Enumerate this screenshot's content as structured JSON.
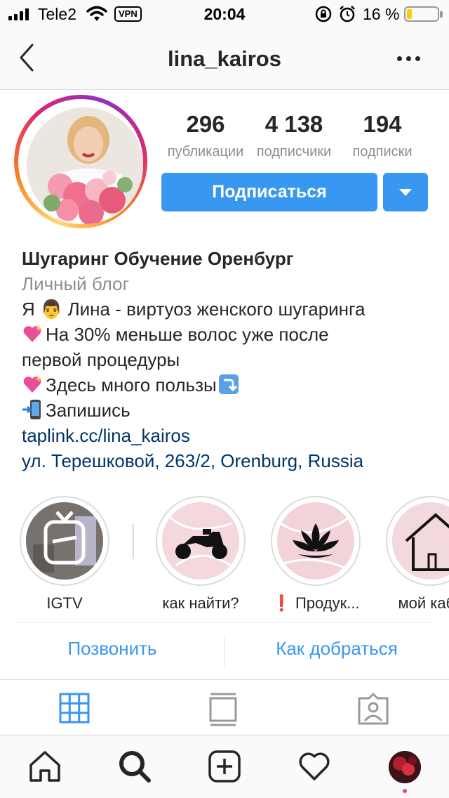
{
  "status_bar": {
    "carrier": "Tele2",
    "vpn": "VPN",
    "time": "20:04",
    "battery_text": "16 %",
    "battery_level": 0.16,
    "battery_color": "#ffcc00"
  },
  "nav": {
    "title": "lina_kairos"
  },
  "profile": {
    "stats": [
      {
        "value": "296",
        "label": "публикации"
      },
      {
        "value": "4 138",
        "label": "подписчики"
      },
      {
        "value": "194",
        "label": "подписки"
      }
    ],
    "follow_label": "Подписаться",
    "accent_color": "#3897f0"
  },
  "bio": {
    "name": "Шугаринг Обучение Оренбург",
    "category": "Личный блог",
    "line1": "Я 👨 Лина - виртуоз женского шугаринга",
    "line2": "На 30% меньше волос уже после",
    "line3": "первой процедуры",
    "line4": "Здесь много пользы",
    "line5": "Запишись",
    "link": "taplink.cc/lina_kairos",
    "address": "ул. Терешковой, 263/2, Orenburg, Russia"
  },
  "highlights": [
    {
      "label": "IGTV",
      "icon": "igtv-icon"
    },
    {
      "label": "как найти?",
      "icon": "motorcycle-icon"
    },
    {
      "label": "❗ Продук...",
      "icon": "lotus-icon"
    },
    {
      "label": "мой каби",
      "icon": "house-icon"
    }
  ],
  "contacts": {
    "call": "Позвонить",
    "directions": "Как добраться"
  },
  "tabs": [
    "grid-icon",
    "igtv-tab-icon",
    "tagged-icon"
  ],
  "bottom_nav": [
    "home-icon",
    "search-icon",
    "add-post-icon",
    "heart-icon",
    "profile-avatar"
  ]
}
